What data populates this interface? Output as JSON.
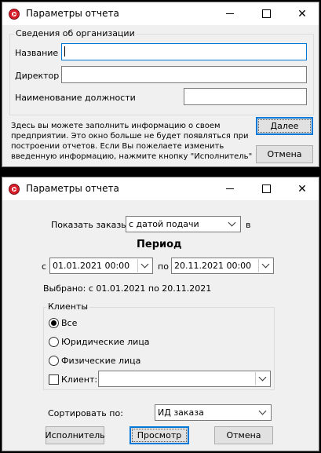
{
  "org_dialog": {
    "title": "Параметры отчета",
    "group_label": "Сведения об организации",
    "fields": {
      "name_label": "Название",
      "name_value": "",
      "director_label": "Директор",
      "director_value": "",
      "position_label": "Наименование должности",
      "position_value": ""
    },
    "info_text": "Здесь вы можете заполнить информацию о своем предприятии. Это окно больше не будет появляться при построении отчетов. Если Вы пожелаете изменить введенную информацию, нажмите кнопку \"Исполнитель\"",
    "next_button": "Далее",
    "cancel_button": "Отмена",
    "window_controls": [
      "minimize-icon",
      "maximize-icon",
      "close-icon"
    ],
    "close_glyph": "✕"
  },
  "report_dialog": {
    "title": "Параметры отчета",
    "show_orders_label": "Показать заказы",
    "show_orders_value": "с датой подачи",
    "in_label": "в",
    "period_title": "Период",
    "from_label": "с",
    "from_value": "01.01.2021 00:00",
    "to_label": "по",
    "to_value": "20.11.2021 00:00",
    "selected_text": "Выбрано: с 01.01.2021 по 20.11.2021",
    "clients_group_label": "Клиенты",
    "radio_all": "Все",
    "radio_legal": "Юридические лица",
    "radio_individual": "Физические лица",
    "client_checkbox_label": "Клиент:",
    "client_value": "",
    "selected_radio": "all",
    "sort_label": "Сортировать по:",
    "sort_value": "ИД заказа",
    "executor_button": "Исполнитель",
    "view_button": "Просмотр",
    "cancel_button": "Отмена",
    "close_glyph": "✕"
  }
}
